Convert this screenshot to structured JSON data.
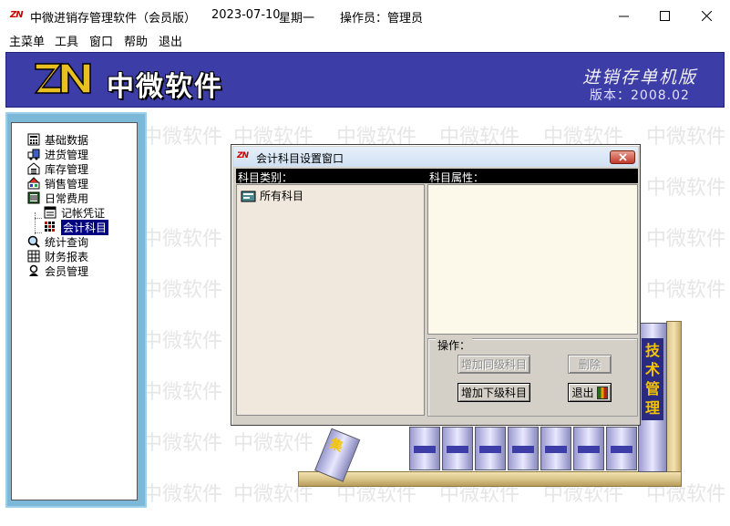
{
  "window": {
    "logo_text": "ZN",
    "title": "中微进销存管理软件（会员版）",
    "date": "2023-07-10",
    "weekday": "星期一",
    "operator": "操作员：管理员"
  },
  "menu": [
    "主菜单",
    "工具",
    "窗口",
    "帮助",
    "退出"
  ],
  "banner": {
    "brand": "中微软件",
    "edition": "进销存单机版",
    "version": "版本：2008.02"
  },
  "watermark": "中微软件",
  "tree": {
    "items": [
      {
        "label": "基础数据",
        "icon": "calculator-icon"
      },
      {
        "label": "进货管理",
        "icon": "truck-icon"
      },
      {
        "label": "库存管理",
        "icon": "warehouse-icon"
      },
      {
        "label": "销售管理",
        "icon": "sales-icon"
      },
      {
        "label": "日常费用",
        "icon": "ledger-icon"
      },
      {
        "label": "记帐凭证",
        "icon": "voucher-icon"
      },
      {
        "label": "会计科目",
        "icon": "grid-icon"
      },
      {
        "label": "统计查询",
        "icon": "magnifier-icon"
      },
      {
        "label": "财务报表",
        "icon": "report-icon"
      },
      {
        "label": "会员管理",
        "icon": "member-icon"
      }
    ],
    "selected": "会计科目"
  },
  "books": {
    "spine_label": "技术管理",
    "tilt_label": "集"
  },
  "dialog": {
    "logo_text": "ZN",
    "title": "会计科目设置窗口",
    "category_header": "科目类别：",
    "attribute_header": "科目属性：",
    "root_node": "所有科目",
    "ops_label": "操作：",
    "btn_add_sibling": "增加同级科目",
    "btn_delete": "删除",
    "btn_add_child": "增加下级科目",
    "btn_exit": "退出"
  }
}
